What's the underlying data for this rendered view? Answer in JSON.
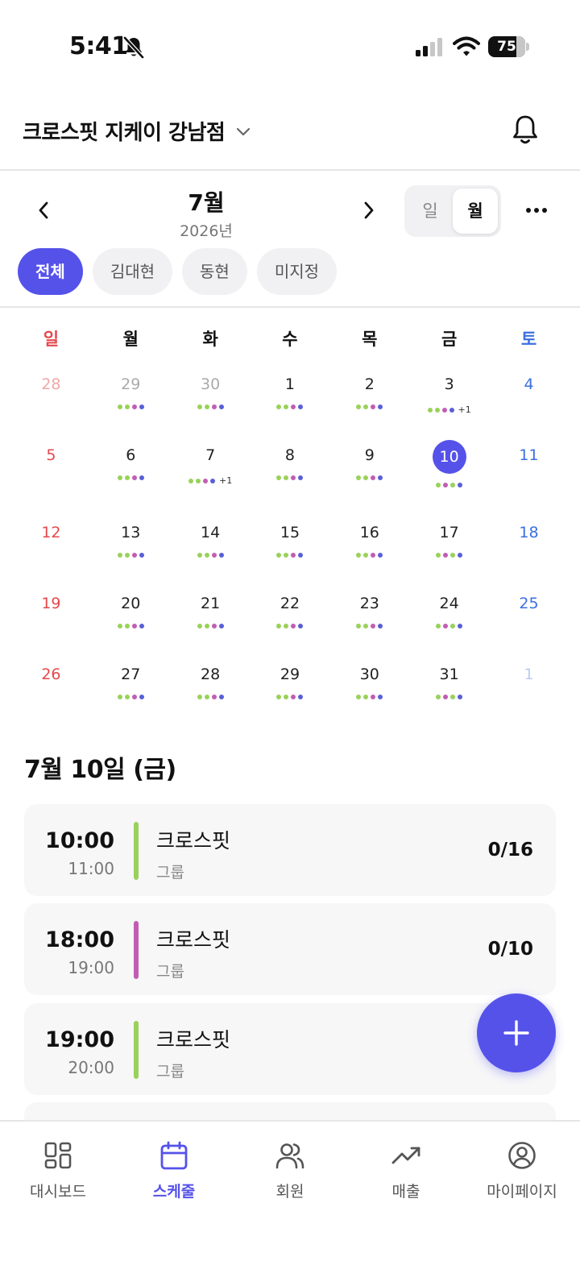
{
  "status_bar": {
    "time": "5:41",
    "battery": "75"
  },
  "header": {
    "gym_name": "크로스핏 지케이 강남점"
  },
  "calendar_nav": {
    "month": "7월",
    "year": "2026년",
    "view_day": "일",
    "view_month": "월",
    "active_view": "월"
  },
  "filters": [
    {
      "label": "전체",
      "active": true
    },
    {
      "label": "김대현",
      "active": false
    },
    {
      "label": "동현",
      "active": false
    },
    {
      "label": "미지정",
      "active": false
    }
  ],
  "colors": {
    "accent": "#5552ea",
    "green": "#9ad15a",
    "magenta": "#c25db3",
    "blue": "#5a5fd6",
    "sunday": "#e5484d",
    "saturday": "#3b6fe0"
  },
  "weekdays": [
    "일",
    "월",
    "화",
    "수",
    "목",
    "금",
    "토"
  ],
  "weeks": [
    [
      {
        "n": "28",
        "muted": true,
        "dots": [],
        "more": ""
      },
      {
        "n": "29",
        "muted": true,
        "dots": [
          "green",
          "green",
          "magenta",
          "blue"
        ],
        "more": ""
      },
      {
        "n": "30",
        "muted": true,
        "dots": [
          "green",
          "green",
          "magenta",
          "blue"
        ],
        "more": ""
      },
      {
        "n": "1",
        "dots": [
          "green",
          "green",
          "magenta",
          "blue"
        ],
        "more": ""
      },
      {
        "n": "2",
        "dots": [
          "green",
          "green",
          "magenta",
          "blue"
        ],
        "more": ""
      },
      {
        "n": "3",
        "dots": [
          "green",
          "green",
          "magenta",
          "blue"
        ],
        "more": "+1"
      },
      {
        "n": "4",
        "dots": [],
        "more": ""
      }
    ],
    [
      {
        "n": "5",
        "dots": [],
        "more": ""
      },
      {
        "n": "6",
        "dots": [
          "green",
          "green",
          "magenta",
          "blue"
        ],
        "more": ""
      },
      {
        "n": "7",
        "dots": [
          "green",
          "green",
          "magenta",
          "blue"
        ],
        "more": "+1"
      },
      {
        "n": "8",
        "dots": [
          "green",
          "green",
          "magenta",
          "blue"
        ],
        "more": ""
      },
      {
        "n": "9",
        "dots": [
          "green",
          "green",
          "magenta",
          "blue"
        ],
        "more": ""
      },
      {
        "n": "10",
        "today": true,
        "dots": [
          "green",
          "magenta",
          "green",
          "blue"
        ],
        "more": ""
      },
      {
        "n": "11",
        "dots": [],
        "more": ""
      }
    ],
    [
      {
        "n": "12",
        "dots": [],
        "more": ""
      },
      {
        "n": "13",
        "dots": [
          "green",
          "green",
          "magenta",
          "blue"
        ],
        "more": ""
      },
      {
        "n": "14",
        "dots": [
          "green",
          "green",
          "magenta",
          "blue"
        ],
        "more": ""
      },
      {
        "n": "15",
        "dots": [
          "green",
          "green",
          "magenta",
          "blue"
        ],
        "more": ""
      },
      {
        "n": "16",
        "dots": [
          "green",
          "green",
          "magenta",
          "blue"
        ],
        "more": ""
      },
      {
        "n": "17",
        "dots": [
          "green",
          "magenta",
          "green",
          "blue"
        ],
        "more": ""
      },
      {
        "n": "18",
        "dots": [],
        "more": ""
      }
    ],
    [
      {
        "n": "19",
        "dots": [],
        "more": ""
      },
      {
        "n": "20",
        "dots": [
          "green",
          "green",
          "magenta",
          "blue"
        ],
        "more": ""
      },
      {
        "n": "21",
        "dots": [
          "green",
          "green",
          "magenta",
          "blue"
        ],
        "more": ""
      },
      {
        "n": "22",
        "dots": [
          "green",
          "green",
          "magenta",
          "blue"
        ],
        "more": ""
      },
      {
        "n": "23",
        "dots": [
          "green",
          "green",
          "magenta",
          "blue"
        ],
        "more": ""
      },
      {
        "n": "24",
        "dots": [
          "green",
          "magenta",
          "green",
          "blue"
        ],
        "more": ""
      },
      {
        "n": "25",
        "dots": [],
        "more": ""
      }
    ],
    [
      {
        "n": "26",
        "dots": [],
        "more": ""
      },
      {
        "n": "27",
        "dots": [
          "green",
          "green",
          "magenta",
          "blue"
        ],
        "more": ""
      },
      {
        "n": "28",
        "dots": [
          "green",
          "green",
          "magenta",
          "blue"
        ],
        "more": ""
      },
      {
        "n": "29",
        "dots": [
          "green",
          "green",
          "magenta",
          "blue"
        ],
        "more": ""
      },
      {
        "n": "30",
        "dots": [
          "green",
          "green",
          "magenta",
          "blue"
        ],
        "more": ""
      },
      {
        "n": "31",
        "dots": [
          "green",
          "magenta",
          "green",
          "blue"
        ],
        "more": ""
      },
      {
        "n": "1",
        "muted": true,
        "dots": [],
        "more": ""
      }
    ]
  ],
  "selected_day": {
    "heading": "7월 10일 (금)"
  },
  "classes": [
    {
      "start": "10:00",
      "end": "11:00",
      "name": "크로스핏",
      "type": "그룹",
      "capacity": "0/16",
      "color": "green"
    },
    {
      "start": "18:00",
      "end": "19:00",
      "name": "크로스핏",
      "type": "그룹",
      "capacity": "0/10",
      "color": "magenta"
    },
    {
      "start": "19:00",
      "end": "20:00",
      "name": "크로스핏",
      "type": "그룹",
      "capacity": "",
      "color": "green"
    }
  ],
  "bottom_nav": {
    "items": [
      {
        "label": "대시보드",
        "icon": "dashboard-icon",
        "active": false
      },
      {
        "label": "스케줄",
        "icon": "calendar-icon",
        "active": true
      },
      {
        "label": "회원",
        "icon": "users-icon",
        "active": false
      },
      {
        "label": "매출",
        "icon": "trending-up-icon",
        "active": false
      },
      {
        "label": "마이페이지",
        "icon": "user-circle-icon",
        "active": false
      }
    ]
  }
}
